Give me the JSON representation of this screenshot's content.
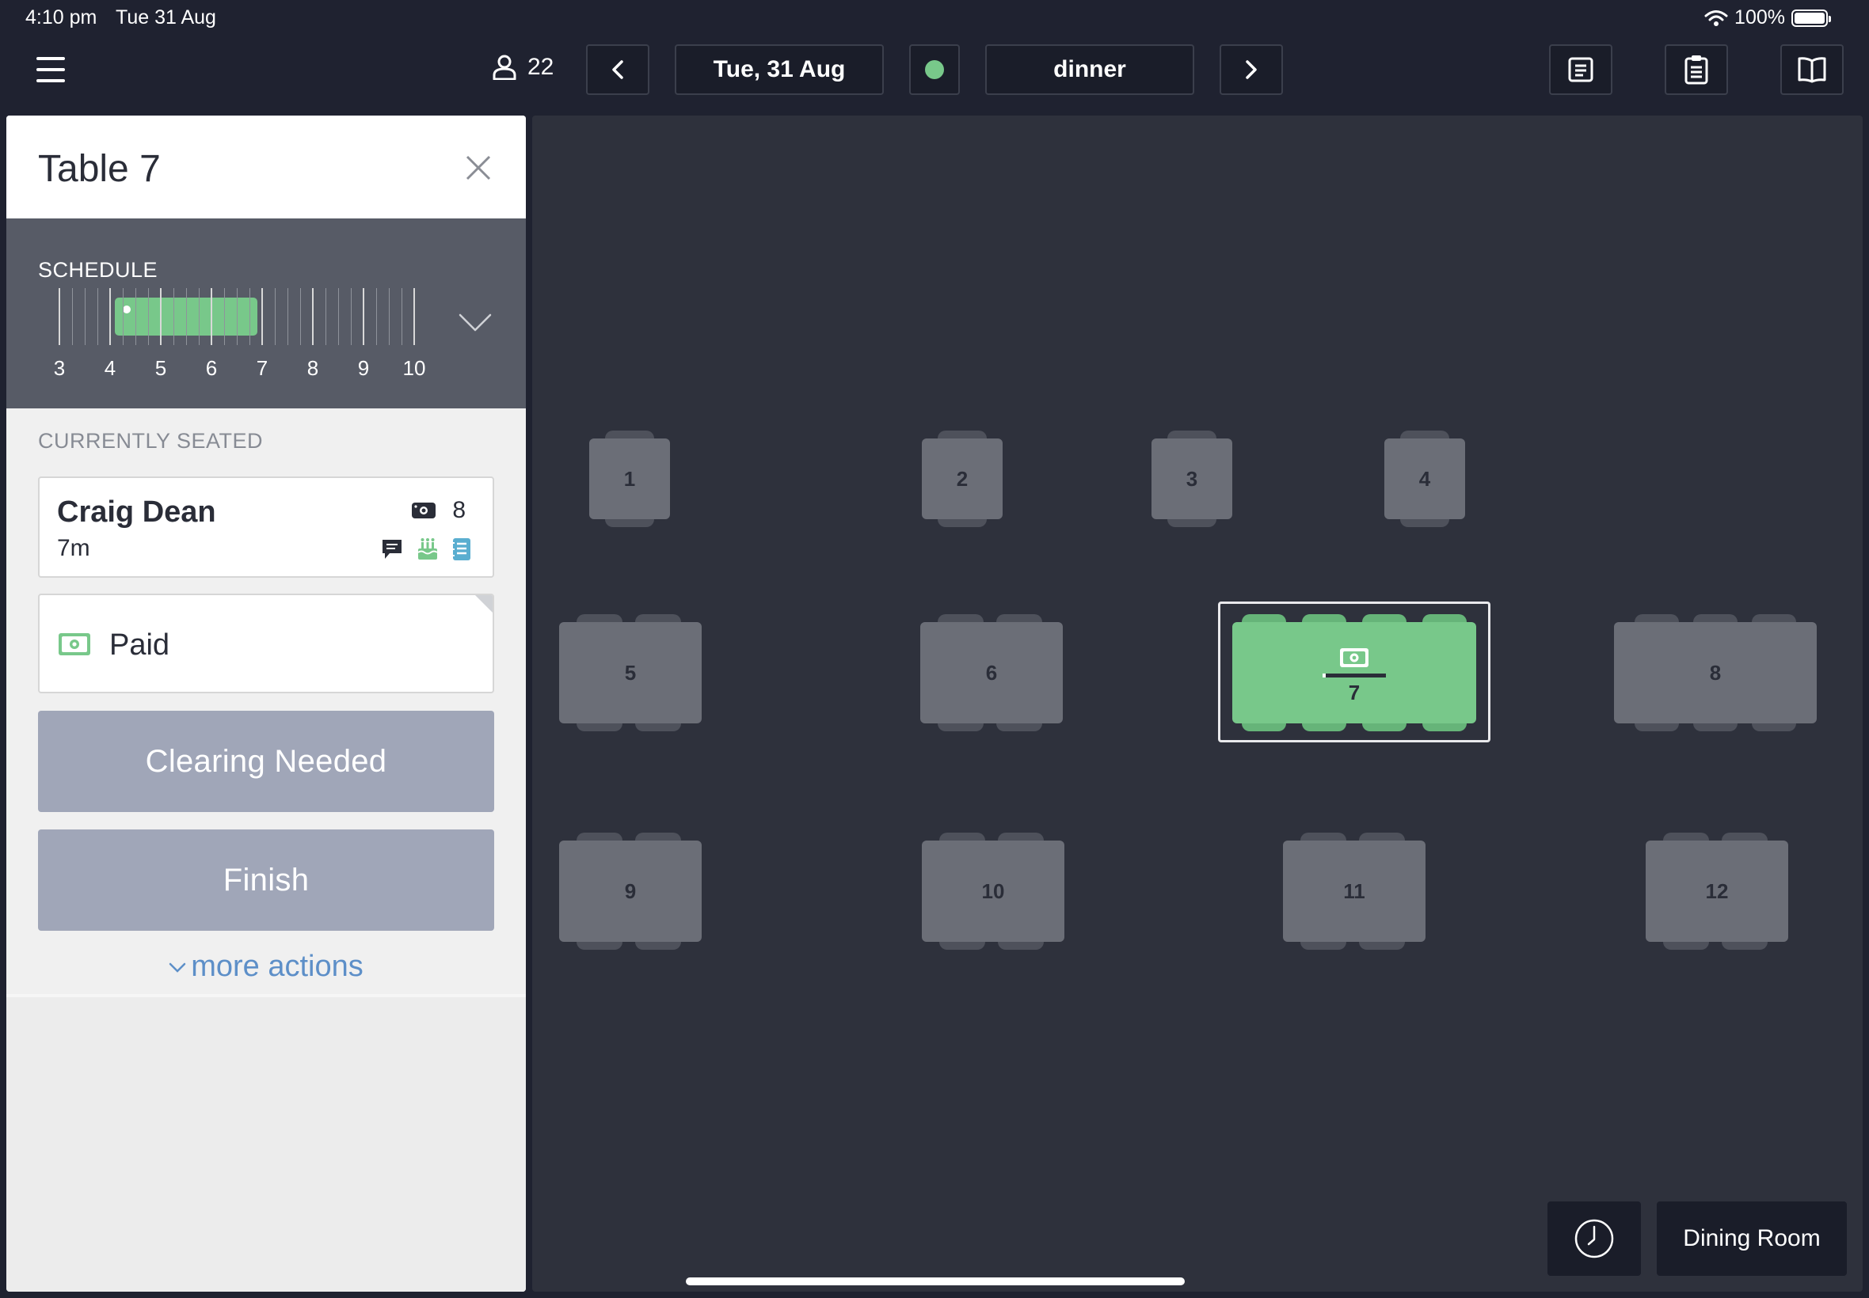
{
  "status_bar": {
    "time": "4:10 pm",
    "date": "Tue 31 Aug",
    "battery": "100%"
  },
  "toolbar": {
    "covers": "22",
    "date": "Tue, 31 Aug",
    "shift": "dinner",
    "status_color": "#78c88a"
  },
  "panel": {
    "title": "Table 7",
    "schedule": {
      "label": "SCHEDULE",
      "hours": [
        "3",
        "4",
        "5",
        "6",
        "7",
        "8",
        "9",
        "10"
      ],
      "booking_start_hour": 4.1,
      "booking_end_hour": 6.9
    },
    "seated_label": "CURRENTLY SEATED",
    "guest": {
      "name": "Craig Dean",
      "duration": "7m",
      "party_size": "8"
    },
    "payment_status": "Paid",
    "clearing_label": "Clearing Needed",
    "finish_label": "Finish",
    "more_actions_label": "more actions"
  },
  "floor": {
    "room_label": "Dining Room",
    "tables": [
      "1",
      "2",
      "3",
      "4",
      "5",
      "6",
      "7",
      "8",
      "9",
      "10",
      "11",
      "12"
    ],
    "selected_table": "7",
    "colors": {
      "selected": "#78c88a",
      "default": "#6b6e77"
    }
  }
}
